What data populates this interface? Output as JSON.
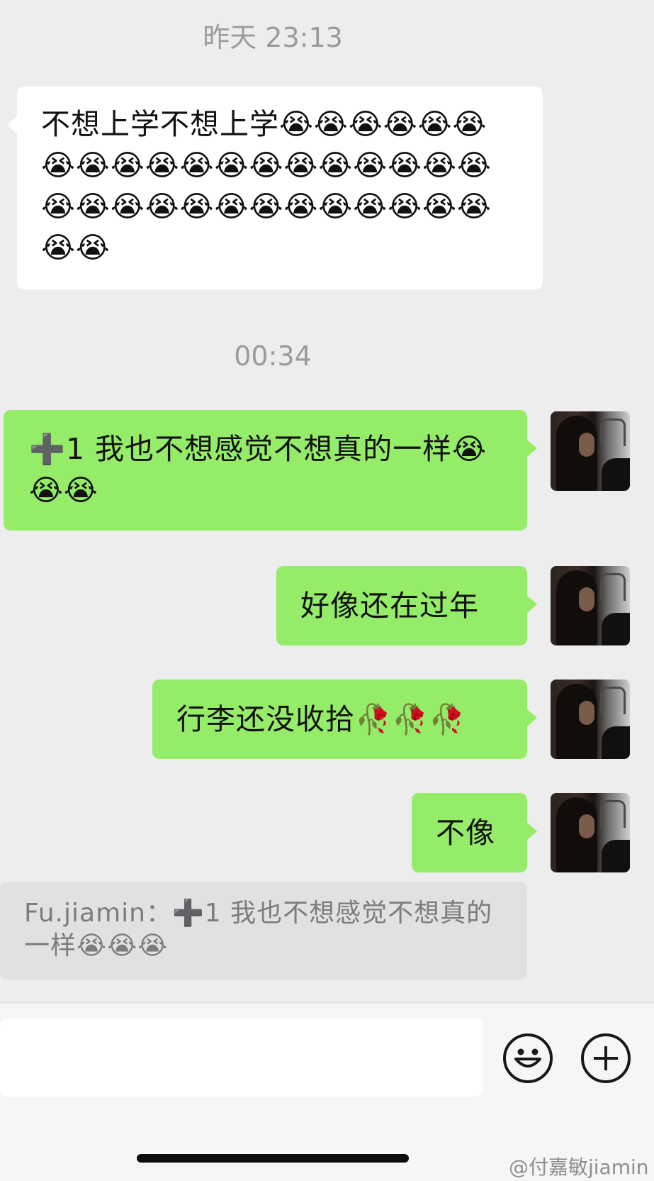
{
  "timestamps": {
    "first": "昨天 23:13",
    "second": "00:34"
  },
  "messages": {
    "incoming_1": "不想上学不想上学😭😭😭😭😭😭😭😭😭😭😭😭😭😭😭😭😭😭😭😭😭😭😭😭😭😭😭😭😭😭😭😭😭😭",
    "outgoing_1": "➕1 我也不想感觉不想真的一样😭😭😭",
    "outgoing_2": "好像还在过年",
    "outgoing_3": "行李还没收拾🥀🥀🥀",
    "outgoing_4": "不像"
  },
  "quote": {
    "sender": "Fu.jiamin：",
    "text": "➕1 我也不想感觉不想真的一样😭😭😭"
  },
  "input": {
    "value": ""
  },
  "icons": {
    "emoji": "smiley-face-icon",
    "more": "plus-circle-icon"
  },
  "watermark": "@付嘉敏jiamin",
  "colors": {
    "background": "#ededed",
    "outgoing_bubble": "#95ec69",
    "incoming_bubble": "#ffffff"
  }
}
